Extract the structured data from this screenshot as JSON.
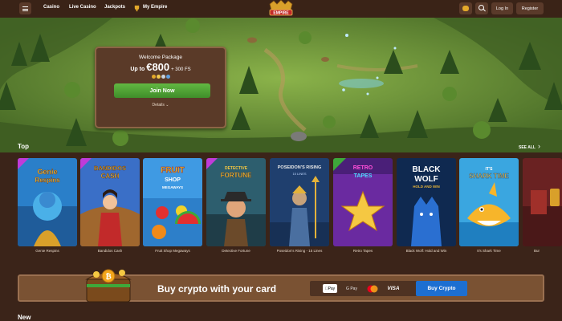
{
  "topbar": {
    "menu_icon": "hamburger-menu-icon",
    "nav": [
      {
        "label": "Casino"
      },
      {
        "label": "Live Casino"
      },
      {
        "label": "Jackpots"
      },
      {
        "label": "My Empire",
        "icon": "trophy-icon"
      }
    ],
    "logo_text": "EMPIRE",
    "coin_icon": "coin-icon",
    "search_icon": "search-icon",
    "login_label": "Log In",
    "register_label": "Register"
  },
  "hero": {
    "welcome_title": "Welcome Package",
    "offer_prefix": "Up to",
    "offer_amount": "€800",
    "offer_suffix": "+ 300 FS",
    "join_label": "Join Now",
    "details_label": "Details",
    "pay_dot_colors": [
      "#e3a82a",
      "#f2c94c",
      "#c9d2dc",
      "#5ea0e0"
    ]
  },
  "top_section": {
    "title": "Top",
    "see_all": "SEE ALL",
    "games": [
      {
        "name": "Genie Respins",
        "card_title": "Genie Respins",
        "bg": "#2a7fc9"
      },
      {
        "name": "Bandidos Cash",
        "card_title": "BANDIDOS CASH",
        "bg": "#3a6fc7"
      },
      {
        "name": "Fruit Shop Megaways",
        "card_title": "FRUIT SHOP",
        "bg": "#3f9ae3"
      },
      {
        "name": "Detective Fortune",
        "card_title": "DETECTIVE FORTUNE",
        "bg": "#2d5e6e"
      },
      {
        "name": "Poseidon's Rising - 15 Lines",
        "card_title": "POSEIDON'S RISING",
        "bg": "#1f3f6e"
      },
      {
        "name": "Retro Tapes",
        "card_title": "RETRO TAPES",
        "bg": "#4a1f78"
      },
      {
        "name": "Black Wolf: Hold and Win",
        "card_title": "BLACK WOLF",
        "bg": "#0f2950"
      },
      {
        "name": "It's Shark Time",
        "card_title": "IT'S SHARK TIME",
        "bg": "#3aa6e0"
      },
      {
        "name": "Bur",
        "card_title": "",
        "bg": "#6a2222"
      }
    ]
  },
  "crypto": {
    "text": "Buy crypto with your card",
    "payments": [
      "Pay",
      "G Pay",
      "VISA"
    ],
    "button_label": "Buy Crypto"
  },
  "new_section": {
    "title": "New"
  }
}
